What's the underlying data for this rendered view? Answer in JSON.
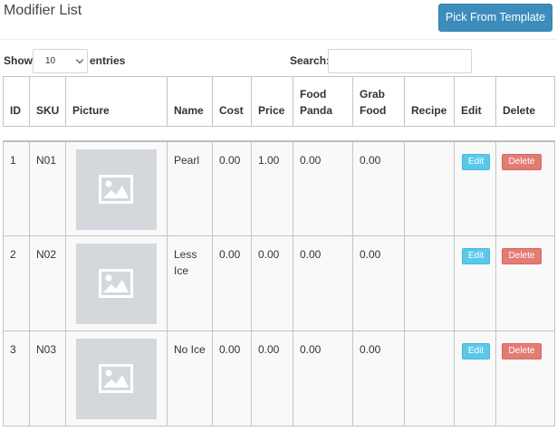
{
  "header": {
    "title": "Modifier List",
    "template_button": "Pick From Template"
  },
  "controls": {
    "show_label": "Show",
    "page_length": "10",
    "entries_label": "entries",
    "search_label": "Search:",
    "search_value": ""
  },
  "table": {
    "columns": [
      "ID",
      "SKU",
      "Picture",
      "Name",
      "Cost",
      "Price",
      "Food Panda",
      "Grab Food",
      "Recipe",
      "Edit",
      "Delete"
    ],
    "rows": [
      {
        "id": "1",
        "sku": "N01",
        "picture": "image-placeholder-icon",
        "name": "Pearl",
        "cost": "0.00",
        "price": "1.00",
        "food_panda": "0.00",
        "grab_food": "0.00",
        "recipe": "",
        "edit": "Edit",
        "delete": "Delete"
      },
      {
        "id": "2",
        "sku": "N02",
        "picture": "image-placeholder-icon",
        "name": "Less Ice",
        "cost": "0.00",
        "price": "0.00",
        "food_panda": "0.00",
        "grab_food": "0.00",
        "recipe": "",
        "edit": "Edit",
        "delete": "Delete"
      },
      {
        "id": "3",
        "sku": "N03",
        "picture": "image-placeholder-icon",
        "name": "No Ice",
        "cost": "0.00",
        "price": "0.00",
        "food_panda": "0.00",
        "grab_food": "0.00",
        "recipe": "",
        "edit": "Edit",
        "delete": "Delete"
      }
    ]
  },
  "colors": {
    "primary": "#3c8dbc",
    "info": "#5bc8ea",
    "danger": "#e37c74"
  }
}
